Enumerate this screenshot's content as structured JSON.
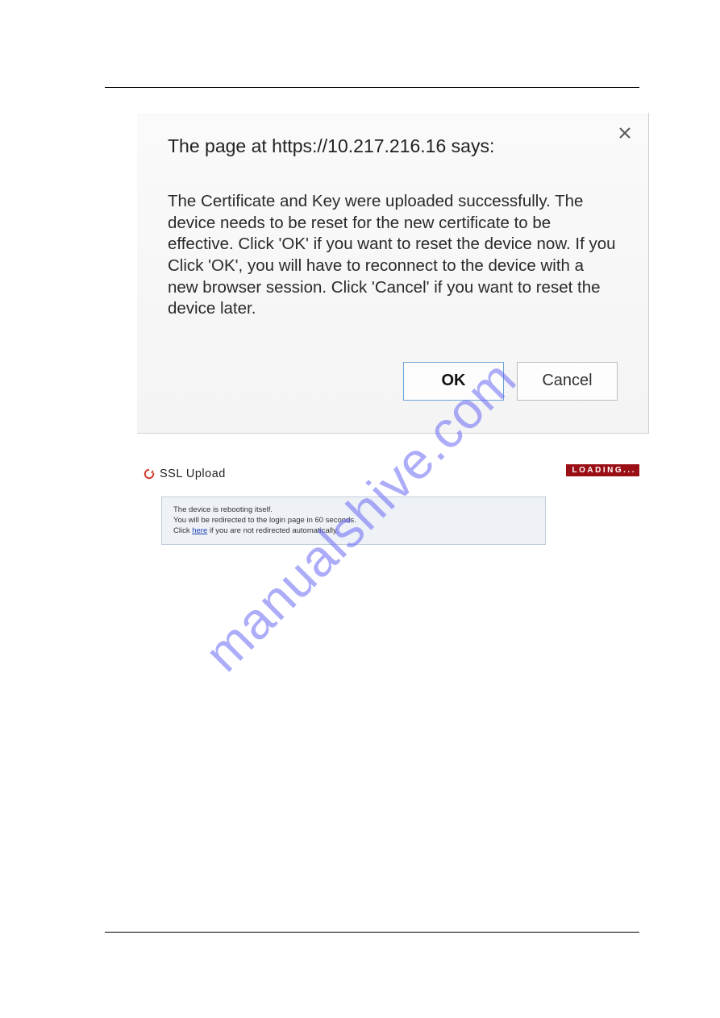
{
  "dialog": {
    "title": "The page at https://10.217.216.16 says:",
    "body": "The Certificate and Key were uploaded successfully. The device needs to be reset for the new certificate to be effective. Click 'OK' if you want to reset the device now. If you Click 'OK', you will have to reconnect to the device with a new browser session. Click 'Cancel' if you want to reset the device later.",
    "ok_label": "OK",
    "cancel_label": "Cancel"
  },
  "ssl": {
    "title": "SSL Upload",
    "loading_label": "LOADING...",
    "status_line1": "The device is rebooting itself.",
    "status_line2": "You will be redirected to the login page in 60 seconds.",
    "status_line3_pre": "Click ",
    "status_line3_link": "here",
    "status_line3_post": " if you are not redirected automatically."
  },
  "watermark": "manualshive.com"
}
